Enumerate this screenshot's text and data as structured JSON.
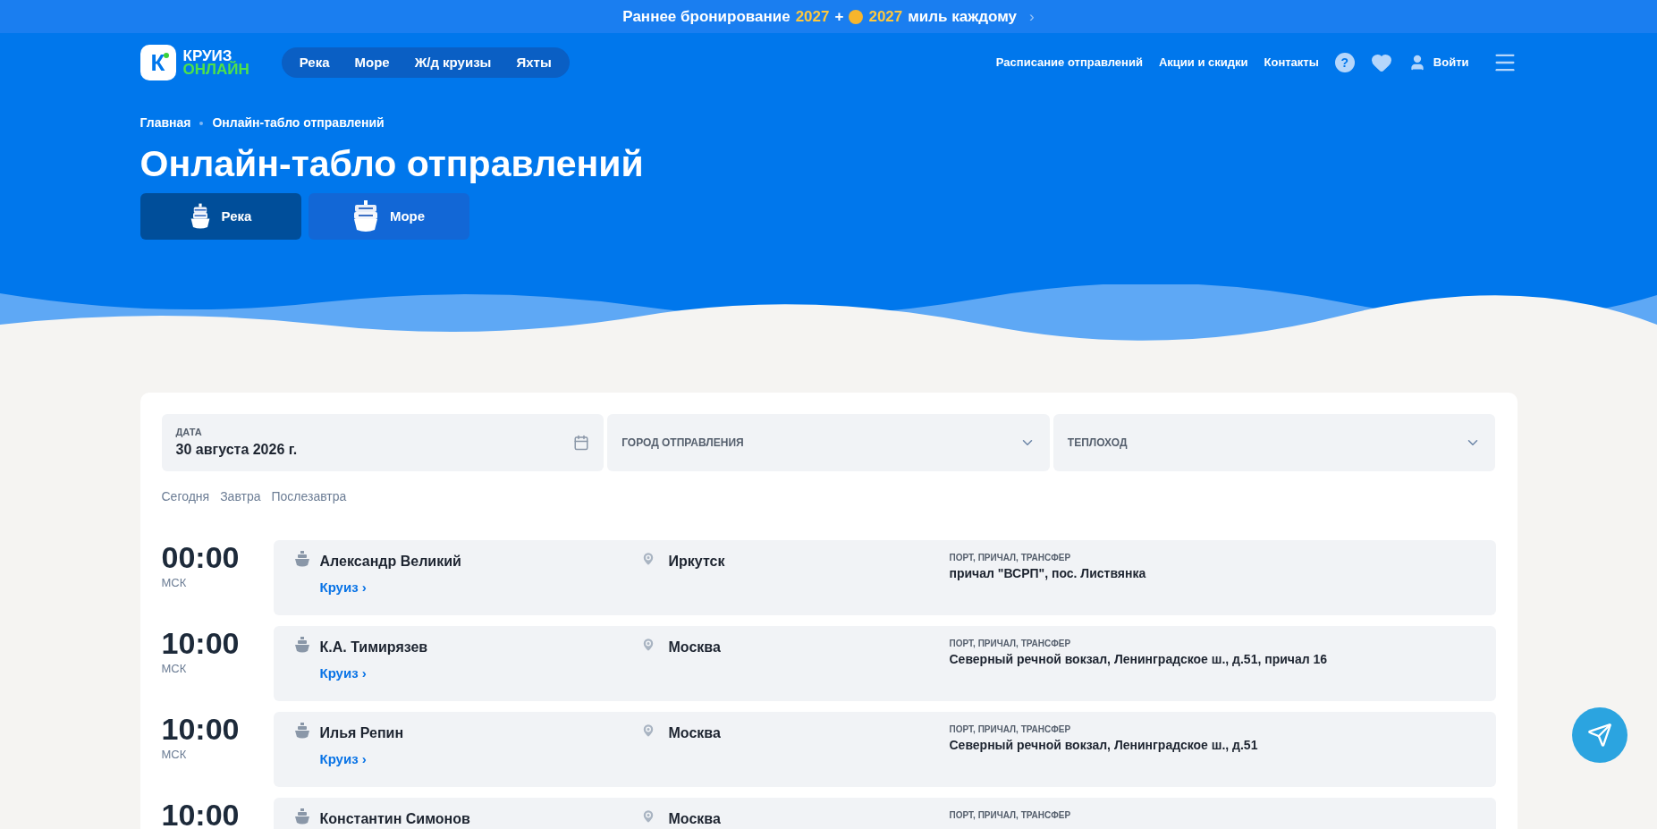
{
  "promo_banner": {
    "parts": [
      {
        "kind": "text",
        "text": "Раннее бронирование",
        "highlight": false
      },
      {
        "kind": "text",
        "text": "2027",
        "highlight": true
      },
      {
        "kind": "text",
        "text": "+",
        "highlight": false
      },
      {
        "kind": "coin"
      },
      {
        "kind": "text",
        "text": "2027",
        "highlight": true
      },
      {
        "kind": "text",
        "text": "миль каждому",
        "highlight": false
      }
    ],
    "arrow": "›"
  },
  "logo": {
    "mark": "К",
    "line1": "КРУИЗ",
    "line2": "ОНЛАЙН"
  },
  "nav": [
    "Река",
    "Море",
    "Ж/д круизы",
    "Яхты"
  ],
  "header_links": [
    "Расписание отправлений",
    "Акции и скидки",
    "Контакты"
  ],
  "login": "Войти",
  "help": "?",
  "breadcrumbs": [
    "Главная",
    "Онлайн-табло отправлений"
  ],
  "title": "Онлайн-табло отправлений",
  "tabs": [
    {
      "label": "Река",
      "selected": true,
      "kind": "river"
    },
    {
      "label": "Море",
      "selected": false,
      "kind": "sea"
    }
  ],
  "filters": {
    "date": {
      "label": "ДАТА",
      "value": "30 августа 2026 г."
    },
    "city": {
      "placeholder": "ГОРОД ОТПРАВЛЕНИЯ"
    },
    "ship": {
      "placeholder": "ТЕПЛОХОД"
    }
  },
  "quick_dates": [
    "Сегодня",
    "Завтра",
    "Послезавтра"
  ],
  "departures": [
    {
      "time": "00:00",
      "tz": "МСК",
      "ship": "Александр Великий",
      "link": "Круиз ›",
      "city": "Иркутск",
      "port_label": "ПОРТ, ПРИЧАЛ, ТРАНСФЕР",
      "port": "причал \"ВСРП\", пос. Листвянка"
    },
    {
      "time": "10:00",
      "tz": "МСК",
      "ship": "К.А. Тимирязев",
      "link": "Круиз ›",
      "city": "Москва",
      "port_label": "ПОРТ, ПРИЧАЛ, ТРАНСФЕР",
      "port": "Северный речной вокзал, Ленинградское ш., д.51, причал 16"
    },
    {
      "time": "10:00",
      "tz": "МСК",
      "ship": "Илья Репин",
      "link": "Круиз ›",
      "city": "Москва",
      "port_label": "ПОРТ, ПРИЧАЛ, ТРАНСФЕР",
      "port": "Северный речной вокзал, Ленинградское ш., д.51"
    },
    {
      "time": "10:00",
      "ship": "Константин Симонов",
      "city": "Москва",
      "port_label": "ПОРТ, ПРИЧАЛ, ТРАНСФЕР"
    }
  ]
}
